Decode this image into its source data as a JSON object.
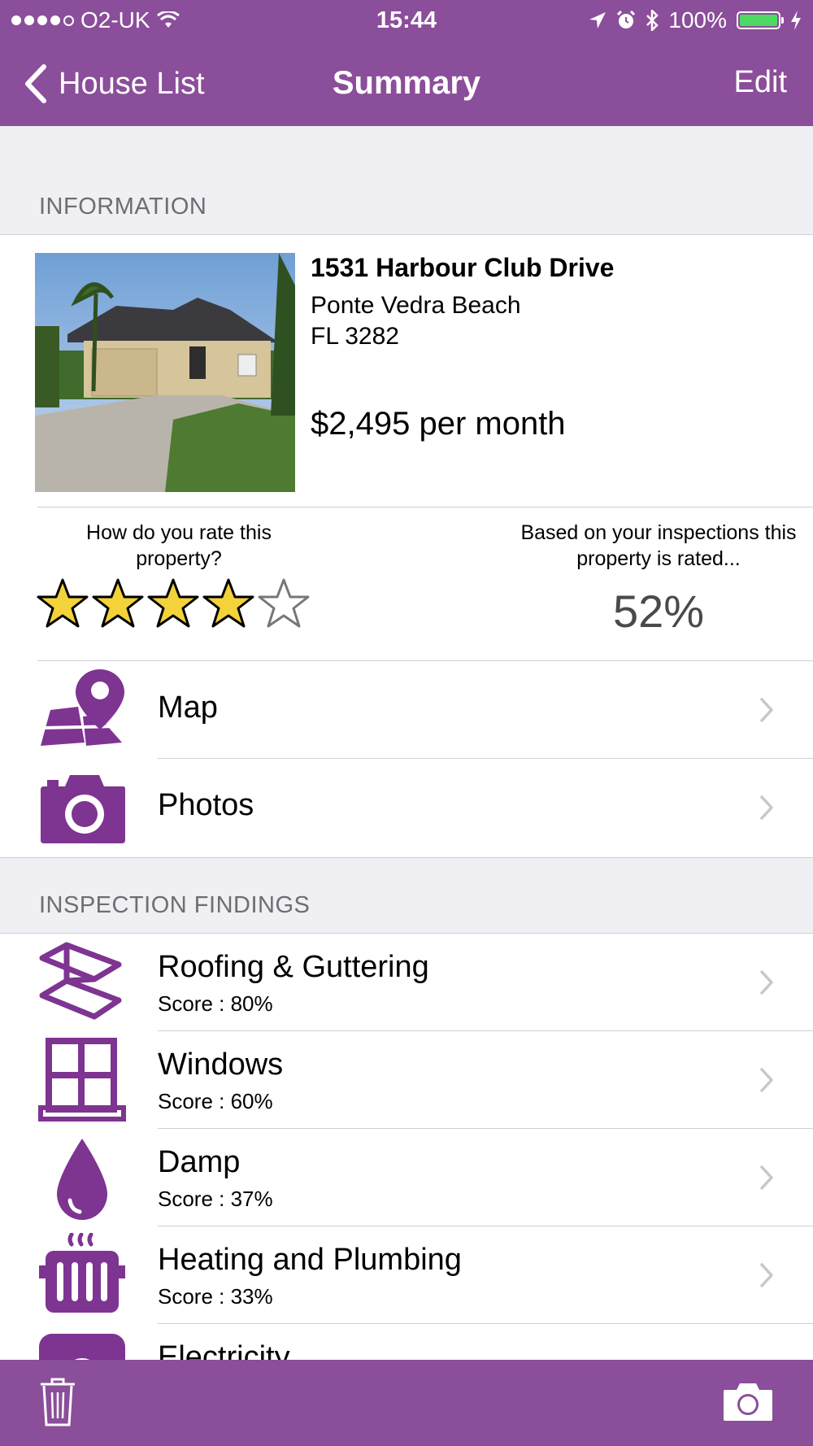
{
  "status_bar": {
    "carrier": "O2-UK",
    "time": "15:44",
    "battery": "100%",
    "signal_bars_filled": 4,
    "signal_bars_total": 5
  },
  "nav": {
    "back_label": "House List",
    "title": "Summary",
    "edit_label": "Edit"
  },
  "information": {
    "header": "INFORMATION",
    "address_line1": "1531 Harbour Club Drive",
    "address_line2": "Ponte Vedra Beach",
    "address_line3": "FL 3282",
    "price": "$2,495 per month",
    "rate_question": "How do you rate this property?",
    "user_rating": 4,
    "rating_max": 5,
    "inspection_rating_text": "Based on your inspections this property is rated...",
    "inspection_rating": "52%"
  },
  "links": [
    {
      "label": "Map",
      "icon": "map-pin-icon"
    },
    {
      "label": "Photos",
      "icon": "camera-icon"
    }
  ],
  "findings": {
    "header": "INSPECTION FINDINGS",
    "items": [
      {
        "label": "Roofing & Guttering",
        "score": "Score : 80%",
        "icon": "roof-icon"
      },
      {
        "label": "Windows",
        "score": "Score : 60%",
        "icon": "window-icon"
      },
      {
        "label": "Damp",
        "score": "Score : 37%",
        "icon": "droplet-icon"
      },
      {
        "label": "Heating and Plumbing",
        "score": "Score : 33%",
        "icon": "radiator-icon"
      },
      {
        "label": "Electricity",
        "icon": "electricity-icon"
      }
    ]
  },
  "colors": {
    "accent": "#8b4e9a",
    "icon_purple": "#7e3491",
    "star_fill": "#f3d23a",
    "background": "#efeff4"
  },
  "toolbar": {
    "left_icon": "trash-icon",
    "right_icon": "camera-icon"
  }
}
